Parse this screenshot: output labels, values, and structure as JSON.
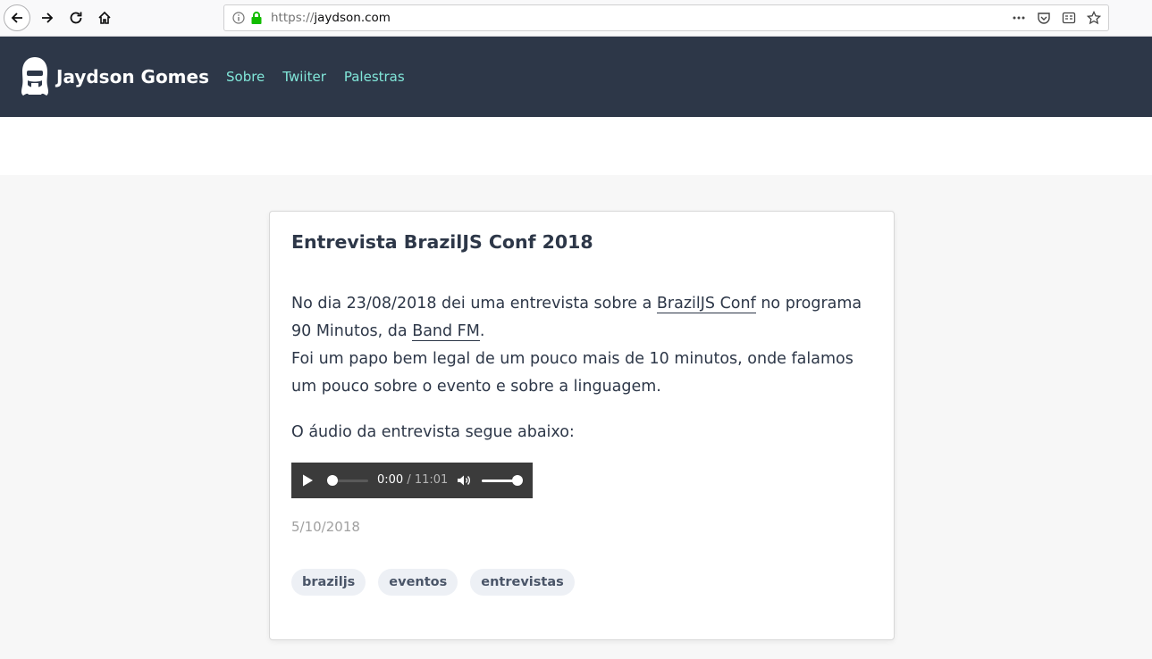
{
  "browser": {
    "url_scheme": "https://",
    "url_host": "jaydson.com"
  },
  "site": {
    "brand": "Jaydson Gomes",
    "nav": [
      "Sobre",
      "Twiiter",
      "Palestras"
    ]
  },
  "post": {
    "title": "Entrevista BrazilJS Conf 2018",
    "p1_a": "No dia 23/08/2018 dei uma entrevista sobre a ",
    "p1_link1": "BrazilJS Conf",
    "p1_b": " no programa 90 Minutos, da ",
    "p1_link2": "Band FM",
    "p1_c": ".",
    "p1_line2": "Foi um papo bem legal de um pouco mais de 10 minutos, onde falamos um pouco sobre o evento e sobre a linguagem.",
    "p2": "O áudio da entrevista segue abaixo:",
    "audio": {
      "current_time": "0:00",
      "separator": " / ",
      "duration": "11:01",
      "progress_fraction": 0.0,
      "volume_fraction": 1.0
    },
    "date": "5/10/2018",
    "tags": [
      "braziljs",
      "eventos",
      "entrevistas"
    ]
  }
}
